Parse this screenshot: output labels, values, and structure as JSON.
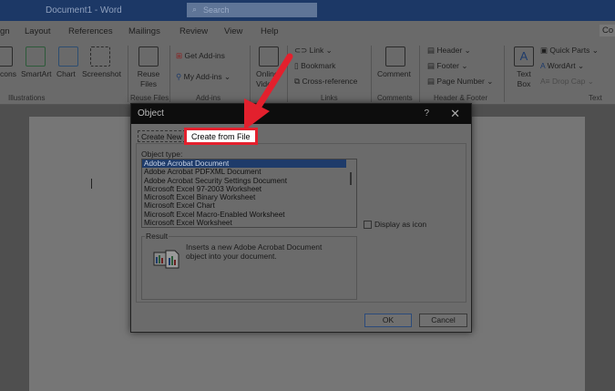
{
  "window": {
    "title": "Document1  -  Word",
    "search_placeholder": "Search"
  },
  "tabs": [
    "gn",
    "Layout",
    "References",
    "Mailings",
    "Review",
    "View",
    "Help"
  ],
  "ribbon": {
    "share": "Co",
    "illustrations": {
      "items": [
        "cons",
        "SmartArt",
        "Chart",
        "Screenshot"
      ],
      "label": "Illustrations"
    },
    "reuse": {
      "item": "Reuse Files",
      "label": "Reuse Files"
    },
    "addins": {
      "get": "Get Add-ins",
      "my": "My Add-ins",
      "label": "Add-ins"
    },
    "media": {
      "item": "Online Video"
    },
    "links": {
      "items": [
        "Link",
        "Bookmark",
        "Cross-reference"
      ],
      "label": "Links"
    },
    "comments": {
      "item": "Comment",
      "label": "Comments"
    },
    "header_footer": {
      "items": [
        "Header",
        "Footer",
        "Page Number"
      ],
      "label": "Header & Footer"
    },
    "text": {
      "textbox": "Text Box",
      "items": [
        "Quick Parts",
        "WordArt",
        "Drop Cap"
      ],
      "label": "Text"
    }
  },
  "dialog": {
    "title": "Object",
    "help": "?",
    "close": "✕",
    "tabs": {
      "create_new": "Create New",
      "create_from_file": "Create from File"
    },
    "object_type_label": "Object type:",
    "object_types": [
      "Adobe Acrobat Document",
      "Adobe Acrobat PDFXML Document",
      "Adobe Acrobat Security Settings Document",
      "Microsoft Excel 97-2003 Worksheet",
      "Microsoft Excel Binary Worksheet",
      "Microsoft Excel Chart",
      "Microsoft Excel Macro-Enabled Worksheet",
      "Microsoft Excel Worksheet"
    ],
    "selected_index": 0,
    "display_as_icon": "Display as icon",
    "result_label": "Result",
    "result_text": "Inserts a new Adobe Acrobat Document object into your document.",
    "ok": "OK",
    "cancel": "Cancel"
  },
  "colors": {
    "highlight": "#e3202d",
    "selection": "#1e3b6a"
  }
}
